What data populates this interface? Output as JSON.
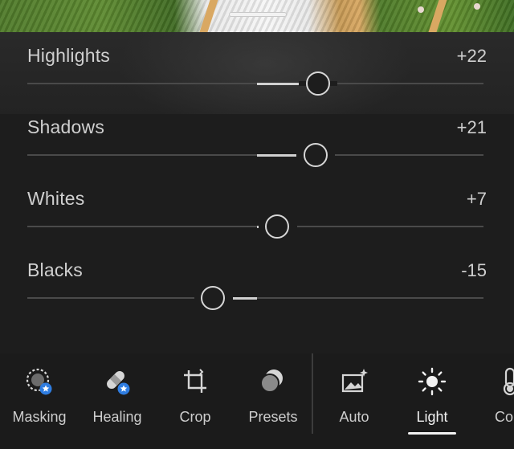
{
  "sliders": [
    {
      "label": "Highlights",
      "value": "+22",
      "level": 22
    },
    {
      "label": "Shadows",
      "value": "+21",
      "level": 21
    },
    {
      "label": "Whites",
      "value": "+7",
      "level": 7
    },
    {
      "label": "Blacks",
      "value": "-15",
      "level": -15
    }
  ],
  "tools": [
    {
      "label": "Masking",
      "icon": "masking-icon",
      "badge": "star-badge"
    },
    {
      "label": "Healing",
      "icon": "healing-icon",
      "badge": "star-badge"
    },
    {
      "label": "Crop",
      "icon": "crop-icon"
    },
    {
      "label": "Presets",
      "icon": "presets-icon"
    },
    {
      "label": "Auto",
      "icon": "auto-icon"
    },
    {
      "label": "Light",
      "icon": "sun-icon",
      "active": true
    },
    {
      "label": "Col",
      "icon": "thermometer-icon"
    }
  ],
  "colors": {
    "accent": "#f2f2f2",
    "badge": "#2f7de1",
    "track": "#4a4a4a"
  }
}
